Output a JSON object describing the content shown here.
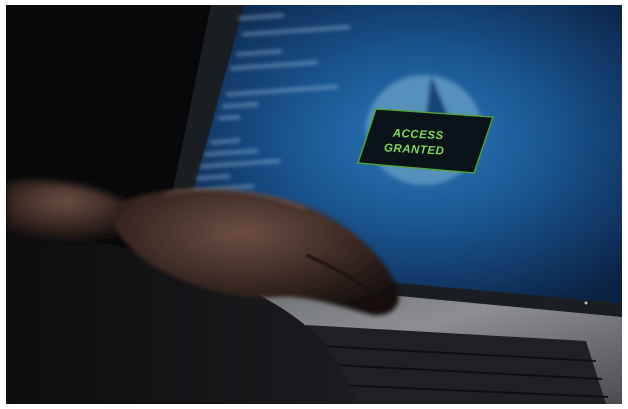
{
  "photo": {
    "subject": "hands-typing-on-laptop",
    "colors": {
      "screen_center": "#1d5f9a",
      "screen_edge": "#0b2346",
      "access_text": "#7ed957",
      "badge_bg": "#0a1418",
      "pie": "#6fa4c7"
    }
  },
  "overlay": {
    "line1": "ACCESS",
    "line2": "GRANTED"
  }
}
